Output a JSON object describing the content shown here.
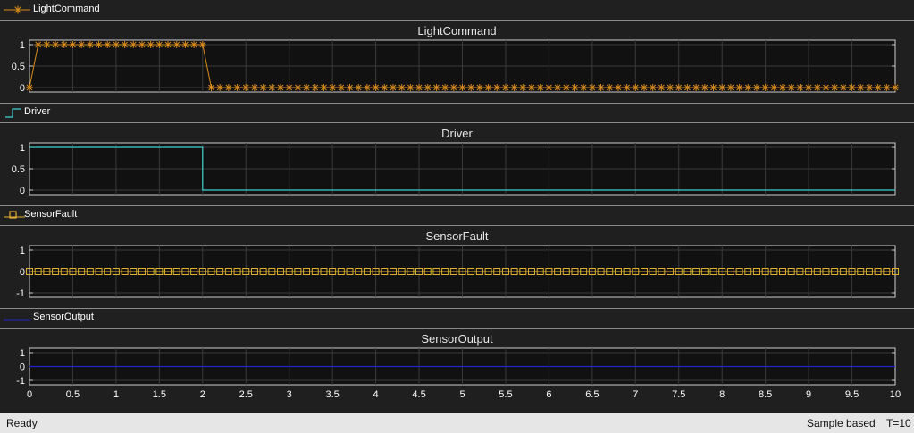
{
  "status": {
    "ready": "Ready",
    "mode": "Sample based",
    "time": "T=10"
  },
  "colors": {
    "background": "#1f1f1f",
    "axes_background": "#111111",
    "grid": "#3a3a3a",
    "light_command": "#d98c1c",
    "driver": "#3fd0cf",
    "sensor_fault": "#e0b030",
    "sensor_output": "#2222cc"
  },
  "chart_data": [
    {
      "type": "line",
      "title": "LightCommand",
      "legend": "LightCommand",
      "marker": "asterisk",
      "color": "#d98c1c",
      "step": false,
      "ylim": [
        0,
        1
      ],
      "yticks": [
        "0",
        "0.5",
        "1"
      ],
      "xlim": [
        0,
        10
      ],
      "sample_interval": 0.1,
      "series": [
        {
          "name": "LightCommand",
          "x_start": 0,
          "x_end": 10,
          "dx": 0.1,
          "segments": [
            {
              "from": 0,
              "to": 0,
              "y": 0
            },
            {
              "from": 0.1,
              "to": 2,
              "y": 1
            },
            {
              "from": 2.1,
              "to": 10,
              "y": 0
            }
          ]
        }
      ]
    },
    {
      "type": "line",
      "title": "Driver",
      "legend": "Driver",
      "marker": "none",
      "color": "#3fd0cf",
      "step": true,
      "ylim": [
        0,
        1
      ],
      "yticks": [
        "0",
        "0.5",
        "1"
      ],
      "xlim": [
        0,
        10
      ],
      "series": [
        {
          "name": "Driver",
          "steps": [
            {
              "x": 0,
              "y": 1
            },
            {
              "x": 2,
              "y": 0
            },
            {
              "x": 10,
              "y": 0
            }
          ]
        }
      ]
    },
    {
      "type": "line",
      "title": "SensorFault",
      "legend": "SensorFault",
      "marker": "square",
      "color": "#e0b030",
      "step": false,
      "ylim": [
        -1,
        1
      ],
      "yticks": [
        "-1",
        "0",
        "1"
      ],
      "xlim": [
        0,
        10
      ],
      "series": [
        {
          "name": "SensorFault",
          "x_start": 0,
          "x_end": 10,
          "dx": 0.1,
          "segments": [
            {
              "from": 0,
              "to": 10,
              "y": 0
            }
          ]
        }
      ]
    },
    {
      "type": "line",
      "title": "SensorOutput",
      "legend": "SensorOutput",
      "marker": "none",
      "color": "#2222cc",
      "step": false,
      "ylim": [
        -1,
        1
      ],
      "yticks": [
        "-1",
        "0",
        "1"
      ],
      "xlim": [
        0,
        10
      ],
      "xticks": [
        "0",
        "0.5",
        "1",
        "1.5",
        "2",
        "2.5",
        "3",
        "3.5",
        "4",
        "4.5",
        "5",
        "5.5",
        "6",
        "6.5",
        "7",
        "7.5",
        "8",
        "8.5",
        "9",
        "9.5",
        "10"
      ],
      "series": [
        {
          "name": "SensorOutput",
          "steps": [
            {
              "x": 0,
              "y": 0
            },
            {
              "x": 10,
              "y": 0
            }
          ]
        }
      ]
    }
  ]
}
